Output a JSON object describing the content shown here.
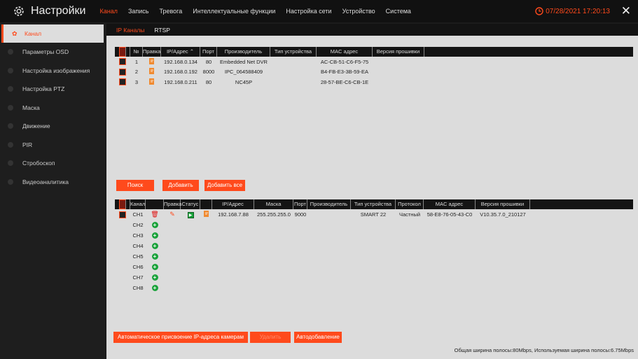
{
  "header": {
    "title": "Настройки",
    "datetime": "07/28/2021 17:20:13",
    "menu": [
      "Канал",
      "Запись",
      "Тревога",
      "Интеллектуальные функции",
      "Настройка сети",
      "Устройство",
      "Система"
    ]
  },
  "sidebar": {
    "items": [
      "Канал",
      "Параметры OSD",
      "Настройка изображения",
      "Настройка PTZ",
      "Маска",
      "Движение",
      "PIR",
      "Стробоскоп",
      "Видеоаналитика"
    ]
  },
  "subtabs": [
    "IP Каналы",
    "RTSP"
  ],
  "search_table": {
    "headers": [
      "",
      "№",
      "Правка",
      "IP/Адрес",
      "Порт",
      "Производитель",
      "Тип устройства",
      "MAC адрес",
      "Версия прошивки"
    ],
    "rows": [
      {
        "no": "1",
        "ip": "192.168.0.134",
        "port": "80",
        "maker": "Embedded Net DVR",
        "mac": "AC-CB-51-C6-F5-75"
      },
      {
        "no": "2",
        "ip": "192.168.0.192",
        "port": "8000",
        "maker": "IPC_064588409",
        "mac": "B4-FB-E3-3B-59-EA"
      },
      {
        "no": "3",
        "ip": "192.168.0.211",
        "port": "80",
        "maker": "NC45P",
        "mac": "28-57-BE-C6-CB-1E"
      }
    ]
  },
  "buttons": {
    "search": "Поиск",
    "add": "Добавить",
    "add_all": "Добавить все",
    "auto_assign": "Автоматическое присвоение IP-адреса камерам",
    "delete": "Удалить",
    "auto_add": "Автодобавление"
  },
  "channel_table": {
    "headers": [
      "",
      "Канал",
      "",
      "Правка",
      "Статус",
      "",
      "IP/Адрес",
      "Маска",
      "Порт",
      "Производитель",
      "Тип устройства",
      "Протокол",
      "MAC адрес",
      "Версия прошивки"
    ],
    "ch1": {
      "name": "CH1",
      "ip": "192.168.7.88",
      "mask": "255.255.255.0",
      "port": "9000",
      "type": "SMART 22",
      "protocol": "Частный",
      "mac": "58-E8-76-05-43-C0",
      "fw": "V10.35.7.0_210127"
    },
    "empty_channels": [
      "CH2",
      "CH3",
      "CH4",
      "CH5",
      "CH6",
      "CH7",
      "CH8"
    ]
  },
  "bandwidth": "Общая ширина полосы:80Mbps, Используемая ширина полосы:6.75Mbps",
  "colors": {
    "accent": "#ff4a1c",
    "status_green": "#19a23a"
  }
}
